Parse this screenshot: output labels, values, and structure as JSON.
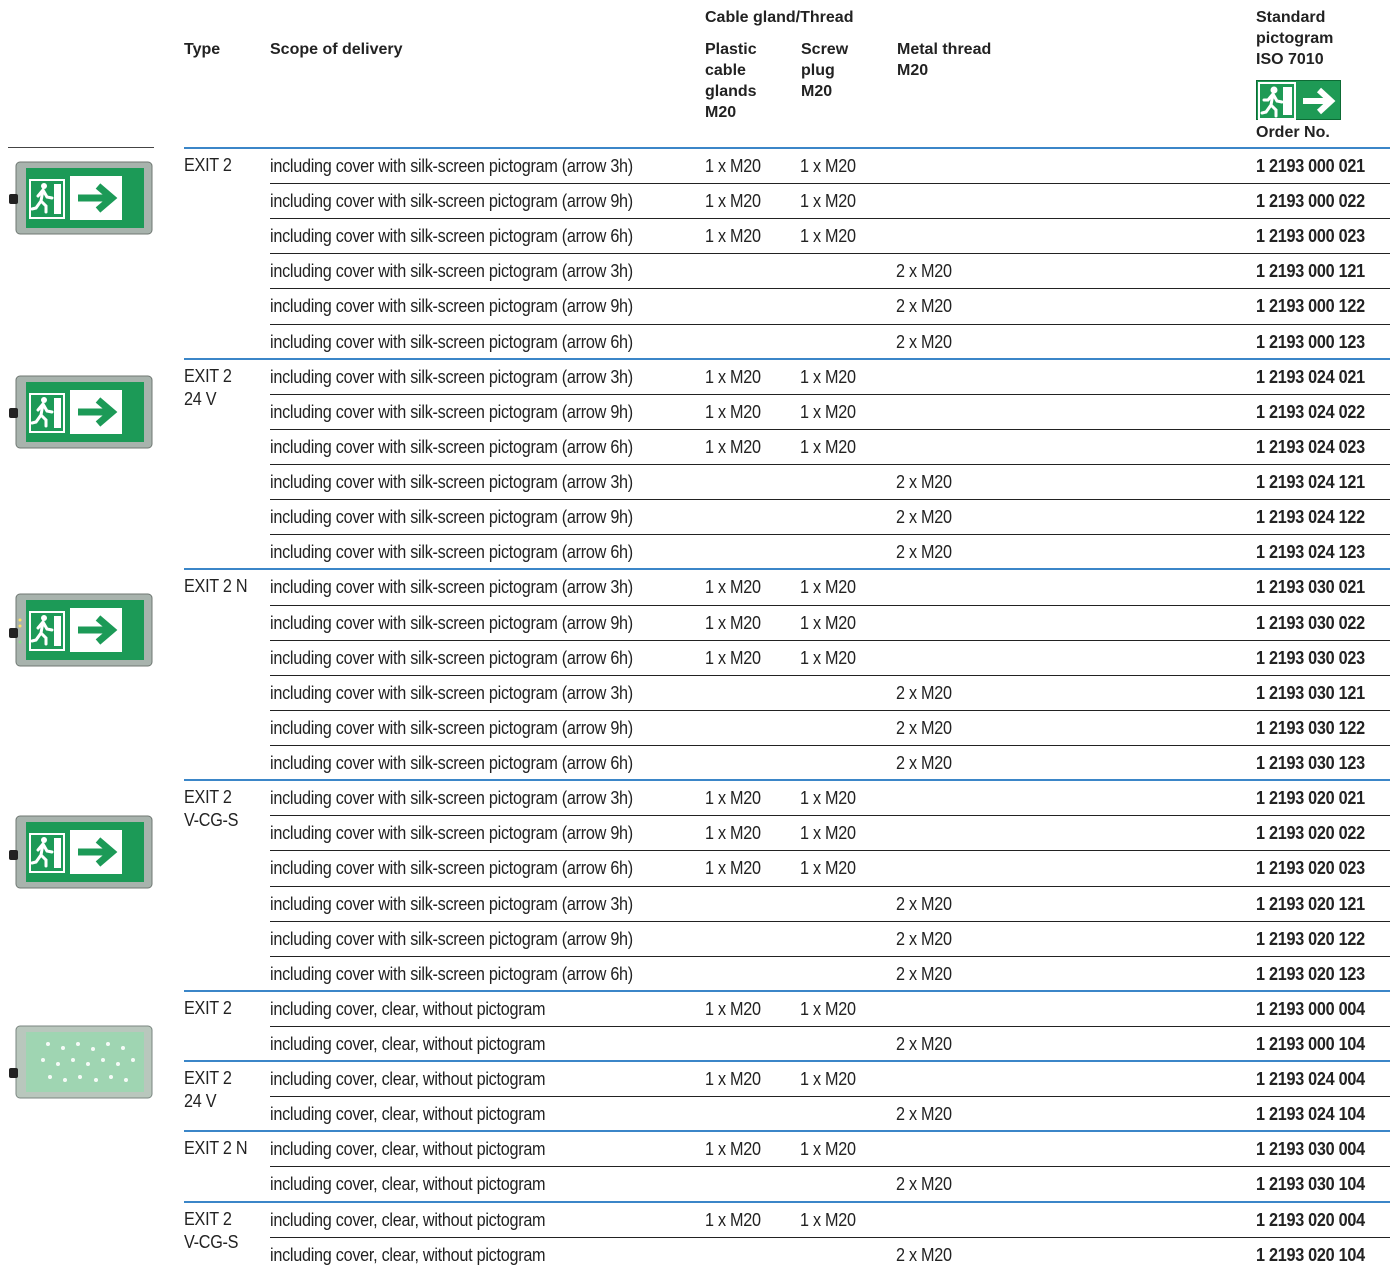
{
  "header": {
    "cable_gland_thread": "Cable gland/Thread",
    "type": "Type",
    "scope_of_delivery": "Scope of delivery",
    "plastic": "Plastic\ncable\nglands\nM20",
    "screw": "Screw\nplug\nM20",
    "metal": "Metal thread\nM20",
    "standard": "Standard\npictogram\nISO 7010",
    "order_no": "Order No."
  },
  "colors": {
    "group_rule": "#3b86c8",
    "row_rule": "#222222",
    "pictogram_green": "#1e9a55"
  },
  "groups": [
    {
      "type": "EXIT 2",
      "rows": [
        {
          "scope": "including cover with silk-screen pictogram (arrow 3h)",
          "plastic": "1 x M20",
          "screw": "1 x M20",
          "metal": "",
          "order": "1 2193 000 021"
        },
        {
          "scope": "including cover with silk-screen pictogram (arrow 9h)",
          "plastic": "1 x M20",
          "screw": "1 x M20",
          "metal": "",
          "order": "1 2193 000 022"
        },
        {
          "scope": "including cover with silk-screen pictogram (arrow 6h)",
          "plastic": "1 x M20",
          "screw": "1 x M20",
          "metal": "",
          "order": "1 2193 000 023"
        },
        {
          "scope": "including cover with silk-screen pictogram (arrow 3h)",
          "plastic": "",
          "screw": "",
          "metal": "2 x M20",
          "order": "1 2193 000 121"
        },
        {
          "scope": "including cover with silk-screen pictogram (arrow 9h)",
          "plastic": "",
          "screw": "",
          "metal": "2 x M20",
          "order": "1 2193 000 122"
        },
        {
          "scope": "including cover with silk-screen pictogram (arrow 6h)",
          "plastic": "",
          "screw": "",
          "metal": "2 x M20",
          "order": "1 2193 000 123"
        }
      ]
    },
    {
      "type": "EXIT 2\n24 V",
      "rows": [
        {
          "scope": "including cover with silk-screen pictogram (arrow 3h)",
          "plastic": "1 x M20",
          "screw": "1 x M20",
          "metal": "",
          "order": "1 2193 024 021"
        },
        {
          "scope": "including cover with silk-screen pictogram (arrow 9h)",
          "plastic": "1 x M20",
          "screw": "1 x M20",
          "metal": "",
          "order": "1 2193 024 022"
        },
        {
          "scope": "including cover with silk-screen pictogram (arrow 6h)",
          "plastic": "1 x M20",
          "screw": "1 x M20",
          "metal": "",
          "order": "1 2193 024 023"
        },
        {
          "scope": "including cover with silk-screen pictogram (arrow 3h)",
          "plastic": "",
          "screw": "",
          "metal": "2 x M20",
          "order": "1 2193 024 121"
        },
        {
          "scope": "including cover with silk-screen pictogram (arrow 9h)",
          "plastic": "",
          "screw": "",
          "metal": "2 x M20",
          "order": "1 2193 024 122"
        },
        {
          "scope": "including cover with silk-screen pictogram (arrow 6h)",
          "plastic": "",
          "screw": "",
          "metal": "2 x M20",
          "order": "1 2193 024 123"
        }
      ]
    },
    {
      "type": "EXIT 2 N",
      "rows": [
        {
          "scope": "including cover with silk-screen pictogram (arrow 3h)",
          "plastic": "1 x M20",
          "screw": "1 x M20",
          "metal": "",
          "order": "1 2193 030 021"
        },
        {
          "scope": "including cover with silk-screen pictogram (arrow 9h)",
          "plastic": "1 x M20",
          "screw": "1 x M20",
          "metal": "",
          "order": "1 2193 030 022"
        },
        {
          "scope": "including cover with silk-screen pictogram (arrow 6h)",
          "plastic": "1 x M20",
          "screw": "1 x M20",
          "metal": "",
          "order": "1 2193 030 023"
        },
        {
          "scope": "including cover with silk-screen pictogram (arrow 3h)",
          "plastic": "",
          "screw": "",
          "metal": "2 x M20",
          "order": "1 2193 030 121"
        },
        {
          "scope": "including cover with silk-screen pictogram (arrow 9h)",
          "plastic": "",
          "screw": "",
          "metal": "2 x M20",
          "order": "1 2193 030 122"
        },
        {
          "scope": "including cover with silk-screen pictogram (arrow 6h)",
          "plastic": "",
          "screw": "",
          "metal": "2 x M20",
          "order": "1 2193 030 123"
        }
      ]
    },
    {
      "type": "EXIT 2\nV-CG-S",
      "rows": [
        {
          "scope": "including cover with silk-screen pictogram (arrow 3h)",
          "plastic": "1 x M20",
          "screw": "1 x M20",
          "metal": "",
          "order": "1 2193 020 021"
        },
        {
          "scope": "including cover with silk-screen pictogram (arrow 9h)",
          "plastic": "1 x M20",
          "screw": "1 x M20",
          "metal": "",
          "order": "1 2193 020 022"
        },
        {
          "scope": "including cover with silk-screen pictogram (arrow 6h)",
          "plastic": "1 x M20",
          "screw": "1 x M20",
          "metal": "",
          "order": "1 2193 020 023"
        },
        {
          "scope": "including cover with silk-screen pictogram (arrow 3h)",
          "plastic": "",
          "screw": "",
          "metal": "2 x M20",
          "order": "1 2193 020 121"
        },
        {
          "scope": "including cover with silk-screen pictogram (arrow 9h)",
          "plastic": "",
          "screw": "",
          "metal": "2 x M20",
          "order": "1 2193 020 122"
        },
        {
          "scope": "including cover with silk-screen pictogram (arrow 6h)",
          "plastic": "",
          "screw": "",
          "metal": "2 x M20",
          "order": "1 2193 020 123"
        }
      ]
    },
    {
      "type": "EXIT 2",
      "rows": [
        {
          "scope": "including cover, clear, without pictogram",
          "plastic": "1 x M20",
          "screw": "1 x M20",
          "metal": "",
          "order": "1 2193 000 004"
        },
        {
          "scope": "including cover, clear, without pictogram",
          "plastic": "",
          "screw": "",
          "metal": "2 x M20",
          "order": "1 2193 000 104"
        }
      ]
    },
    {
      "type": "EXIT 2\n24 V",
      "rows": [
        {
          "scope": "including cover, clear, without pictogram",
          "plastic": "1 x M20",
          "screw": "1 x M20",
          "metal": "",
          "order": "1 2193 024 004"
        },
        {
          "scope": "including cover, clear, without pictogram",
          "plastic": "",
          "screw": "",
          "metal": "2 x M20",
          "order": "1 2193 024 104"
        }
      ]
    },
    {
      "type": "EXIT 2 N",
      "rows": [
        {
          "scope": "including cover, clear, without pictogram",
          "plastic": "1 x M20",
          "screw": "1 x M20",
          "metal": "",
          "order": "1 2193 030 004"
        },
        {
          "scope": "including cover, clear, without pictogram",
          "plastic": "",
          "screw": "",
          "metal": "2 x M20",
          "order": "1 2193 030 104"
        }
      ]
    },
    {
      "type": "EXIT 2\nV-CG-S",
      "rows": [
        {
          "scope": "including cover, clear, without pictogram",
          "plastic": "1 x M20",
          "screw": "1 x M20",
          "metal": "",
          "order": "1 2193 020 004"
        },
        {
          "scope": "including cover, clear, without pictogram",
          "plastic": "",
          "screw": "",
          "metal": "2 x M20",
          "order": "1 2193 020 104"
        }
      ]
    }
  ],
  "fixtures": [
    {
      "kind": "green-exit-sign"
    },
    {
      "kind": "green-exit-sign"
    },
    {
      "kind": "green-exit-sign"
    },
    {
      "kind": "green-exit-sign"
    },
    {
      "kind": "clear-cover"
    }
  ]
}
